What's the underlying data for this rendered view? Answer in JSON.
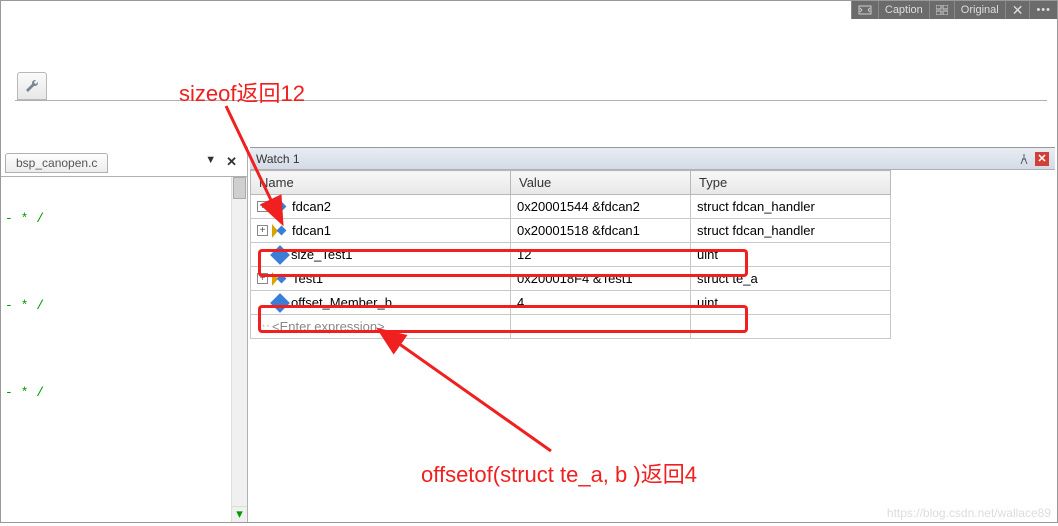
{
  "topstrip": {
    "caption": "Caption",
    "original": "Original"
  },
  "tab": {
    "filename": "bsp_canopen.c"
  },
  "editor": {
    "frag1": "- * /",
    "frag2": "- * /",
    "frag3": "- * /"
  },
  "watch": {
    "title": "Watch 1",
    "columns": {
      "name": "Name",
      "value": "Value",
      "type": "Type"
    },
    "rows": [
      {
        "kind": "struct",
        "expandable": true,
        "name": "fdcan2",
        "value": "0x20001544 &fdcan2",
        "type": "struct fdcan_handler"
      },
      {
        "kind": "struct",
        "expandable": true,
        "name": "fdcan1",
        "value": "0x20001518 &fdcan1",
        "type": "struct fdcan_handler"
      },
      {
        "kind": "var",
        "expandable": false,
        "name": "size_Test1",
        "value": "12",
        "type": "uint"
      },
      {
        "kind": "struct",
        "expandable": true,
        "name": "Test1",
        "value": "0x200018F4 &Test1",
        "type": "struct te_a"
      },
      {
        "kind": "var",
        "expandable": false,
        "name": "offset_Member_b",
        "value": "4",
        "type": "uint"
      }
    ],
    "enter": "<Enter expression>"
  },
  "annotations": {
    "a1": "sizeof返回12",
    "a2": "offsetof(struct te_a, b )返回4"
  },
  "watermark": "https://blog.csdn.net/wallace89"
}
